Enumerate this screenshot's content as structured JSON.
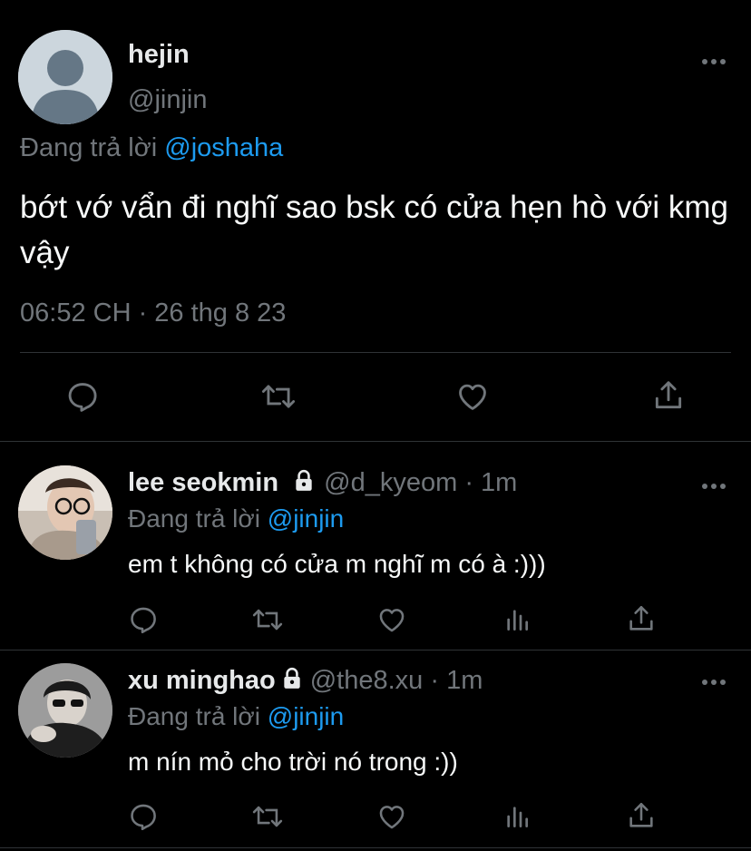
{
  "main_tweet": {
    "name": "hejin",
    "handle": "@jinjin",
    "reply_prefix": "Đang trả lời",
    "reply_to": "@joshaha",
    "text": "bớt vớ vẩn đi nghĩ sao bsk có cửa hẹn hò với kmg vậy",
    "timestamp": "06:52 CH · 26 thg 8 23"
  },
  "replies": [
    {
      "name": "lee seokmin",
      "handle": "@d_kyeom",
      "time": " · 1m",
      "reply_prefix": "Đang trả lời",
      "reply_to": "@jinjin",
      "text": "em t không có cửa m nghĩ m có à :)))"
    },
    {
      "name": "xu minghao",
      "handle": "@the8.xu",
      "time": " · 1m",
      "reply_prefix": "Đang trả lời",
      "reply_to": "@jinjin",
      "text": "m nín mỏ cho trời nó trong :))"
    }
  ],
  "icons": {
    "reply": "reply-icon",
    "retweet": "retweet-icon",
    "like": "heart-icon",
    "share": "share-icon",
    "views": "views-icon",
    "more": "more-icon",
    "lock": "lock-icon"
  },
  "colors": {
    "background": "#000000",
    "text": "#e7e9ea",
    "muted": "#71767b",
    "link": "#1d9bf0",
    "divider": "#2f3336"
  }
}
